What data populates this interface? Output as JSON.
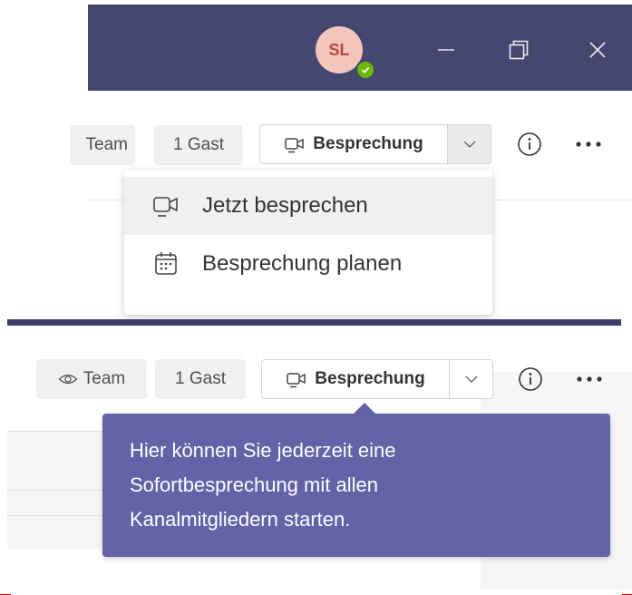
{
  "titlebar": {
    "avatar_initials": "SL",
    "presence": "available",
    "minimize_icon": "minimize-icon",
    "restore_icon": "restore-icon",
    "close_icon": "close-icon"
  },
  "top_toolbar": {
    "team_chip_label": "Team",
    "guest_chip_label": "1 Gast",
    "meet_button_label": "Besprechung",
    "info_icon": "info-icon",
    "more_icon": "more-icon"
  },
  "meet_dropdown": {
    "items": [
      {
        "label": "Jetzt besprechen",
        "icon": "video-icon",
        "highlighted": true
      },
      {
        "label": "Besprechung planen",
        "icon": "calendar-icon",
        "highlighted": false
      }
    ]
  },
  "bottom_toolbar": {
    "team_chip_label": "Team",
    "guest_chip_label": "1 Gast",
    "meet_button_label": "Besprechung"
  },
  "tooltip": {
    "lines": [
      "Hier können Sie jederzeit eine",
      "Sofortbesprechung mit allen",
      "Kanalmitgliedern starten."
    ]
  },
  "colors": {
    "titlebar": "#45476f",
    "tooltip": "#6264a7",
    "presence": "#6bb700",
    "avatar_bg": "#f3c5bd",
    "avatar_text": "#b24b3b"
  }
}
